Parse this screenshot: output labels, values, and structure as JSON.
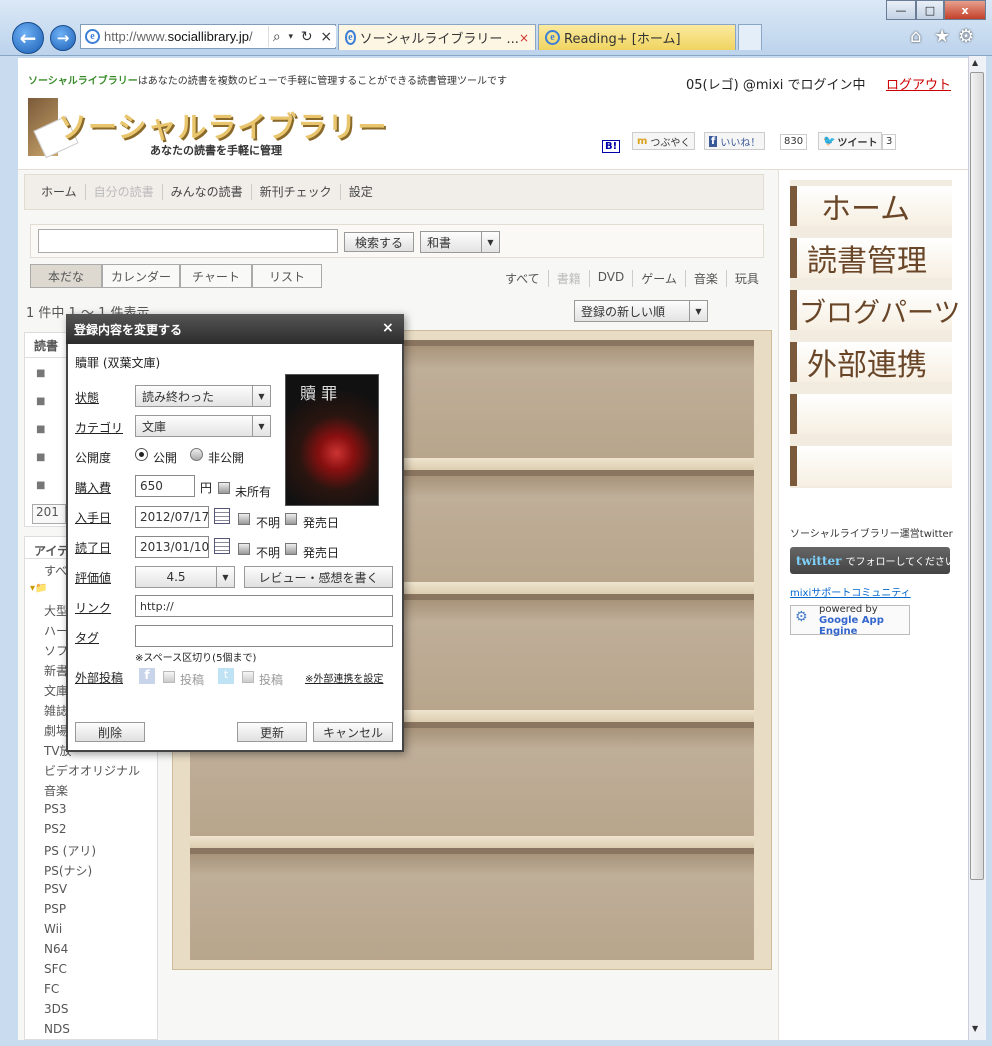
{
  "browser": {
    "url_prefix": "http://www.",
    "url_domain": "sociallibrary.jp",
    "url_suffix": "/",
    "tab1": "ソーシャルライブラリー ...",
    "tab1_close": "×",
    "tab2": "Reading+ [ホーム]",
    "back": "←",
    "forward": "→",
    "search_icon": "⌕",
    "refresh": "↻",
    "stop": "×",
    "home": "⌂",
    "favorites": "★",
    "tools": "⚙",
    "minimize": "—",
    "maximize": "□",
    "close": "x"
  },
  "header": {
    "tagline_brand": "ソーシャルライブラリー",
    "tagline_rest": "はあなたの読書を複数のビューで手軽に管理することができる読書管理ツールです",
    "login_msg": "05(レゴ) @mixi でログイン中",
    "logout": "ログアウト",
    "logo_text": "ソーシャルライブラリー",
    "logo_sub": "あなたの読書を手軽に管理",
    "hatena": "B!",
    "tsubuyaku": "つぶやく",
    "like": "いいね！",
    "like_count": "830",
    "tweet": "ツイート",
    "tweet_count": "3"
  },
  "menu": [
    "ホーム",
    "自分の読書",
    "みんなの読書",
    "新刊チェック",
    "設定"
  ],
  "search": {
    "button": "検索する",
    "category": "和書"
  },
  "views": [
    "本だな",
    "カレンダー",
    "チャート",
    "リスト"
  ],
  "filters": [
    "すべて",
    "書籍",
    "DVD",
    "ゲーム",
    "音楽",
    "玩具"
  ],
  "count_text": "1 件中 1 ～ 1 件表示",
  "sort": "登録の新しい順",
  "sidebar": {
    "heading1": "読書",
    "year_prefix": "201",
    "heading2": "アイテ",
    "item_all": "すべ",
    "items": [
      "大型",
      "ハー",
      "ソフ",
      "新書",
      "文庫",
      "雑誌",
      "劇場",
      "TV放",
      "ビデオオリジナル",
      "音楽",
      "PS3",
      "PS2",
      "PS (アリ)",
      "PS(ナシ)",
      "PSV",
      "PSP",
      "Wii",
      "N64",
      "SFC",
      "FC",
      "3DS",
      "NDS"
    ]
  },
  "right": {
    "nav": [
      "ホーム",
      "読書管理",
      "ブログパーツ",
      "外部連携"
    ],
    "twitter_label": "ソーシャルライブラリー運営twitter",
    "twitter_logo": "twitter",
    "twitter_follow": "でフォローしてください！",
    "mixi_link": "mixiサポートコミュニティ",
    "gae_line1": "powered by",
    "gae_line2": "Google App Engine"
  },
  "modal": {
    "title": "登録内容を変更する",
    "close": "×",
    "book_title": "贖罪 (双葉文庫)",
    "cover_title": "贖 罪",
    "status_label": "状態",
    "status_value": "読み終わった",
    "category_label": "カテゴリ",
    "category_value": "文庫",
    "visibility_label": "公開度",
    "public": "公開",
    "private": "非公開",
    "price_label": "購入費",
    "price_value": "650",
    "yen": "円",
    "not_owned": "未所有",
    "acquired_label": "入手日",
    "acquired_value": "2012/07/17",
    "unknown": "不明",
    "release_date": "発売日",
    "finished_label": "読了日",
    "finished_value": "2013/01/10",
    "rating_label": "評価値",
    "rating_value": "4.5",
    "review_button": "レビュー・感想を書く",
    "link_label": "リンク",
    "link_value": "http://",
    "tag_label": "タグ",
    "tag_hint": "※スペース区切り(5個まで)",
    "external_label": "外部投稿",
    "post": "投稿",
    "external_settings": "※外部連携を設定",
    "delete": "削除",
    "update": "更新",
    "cancel": "キャンセル"
  }
}
